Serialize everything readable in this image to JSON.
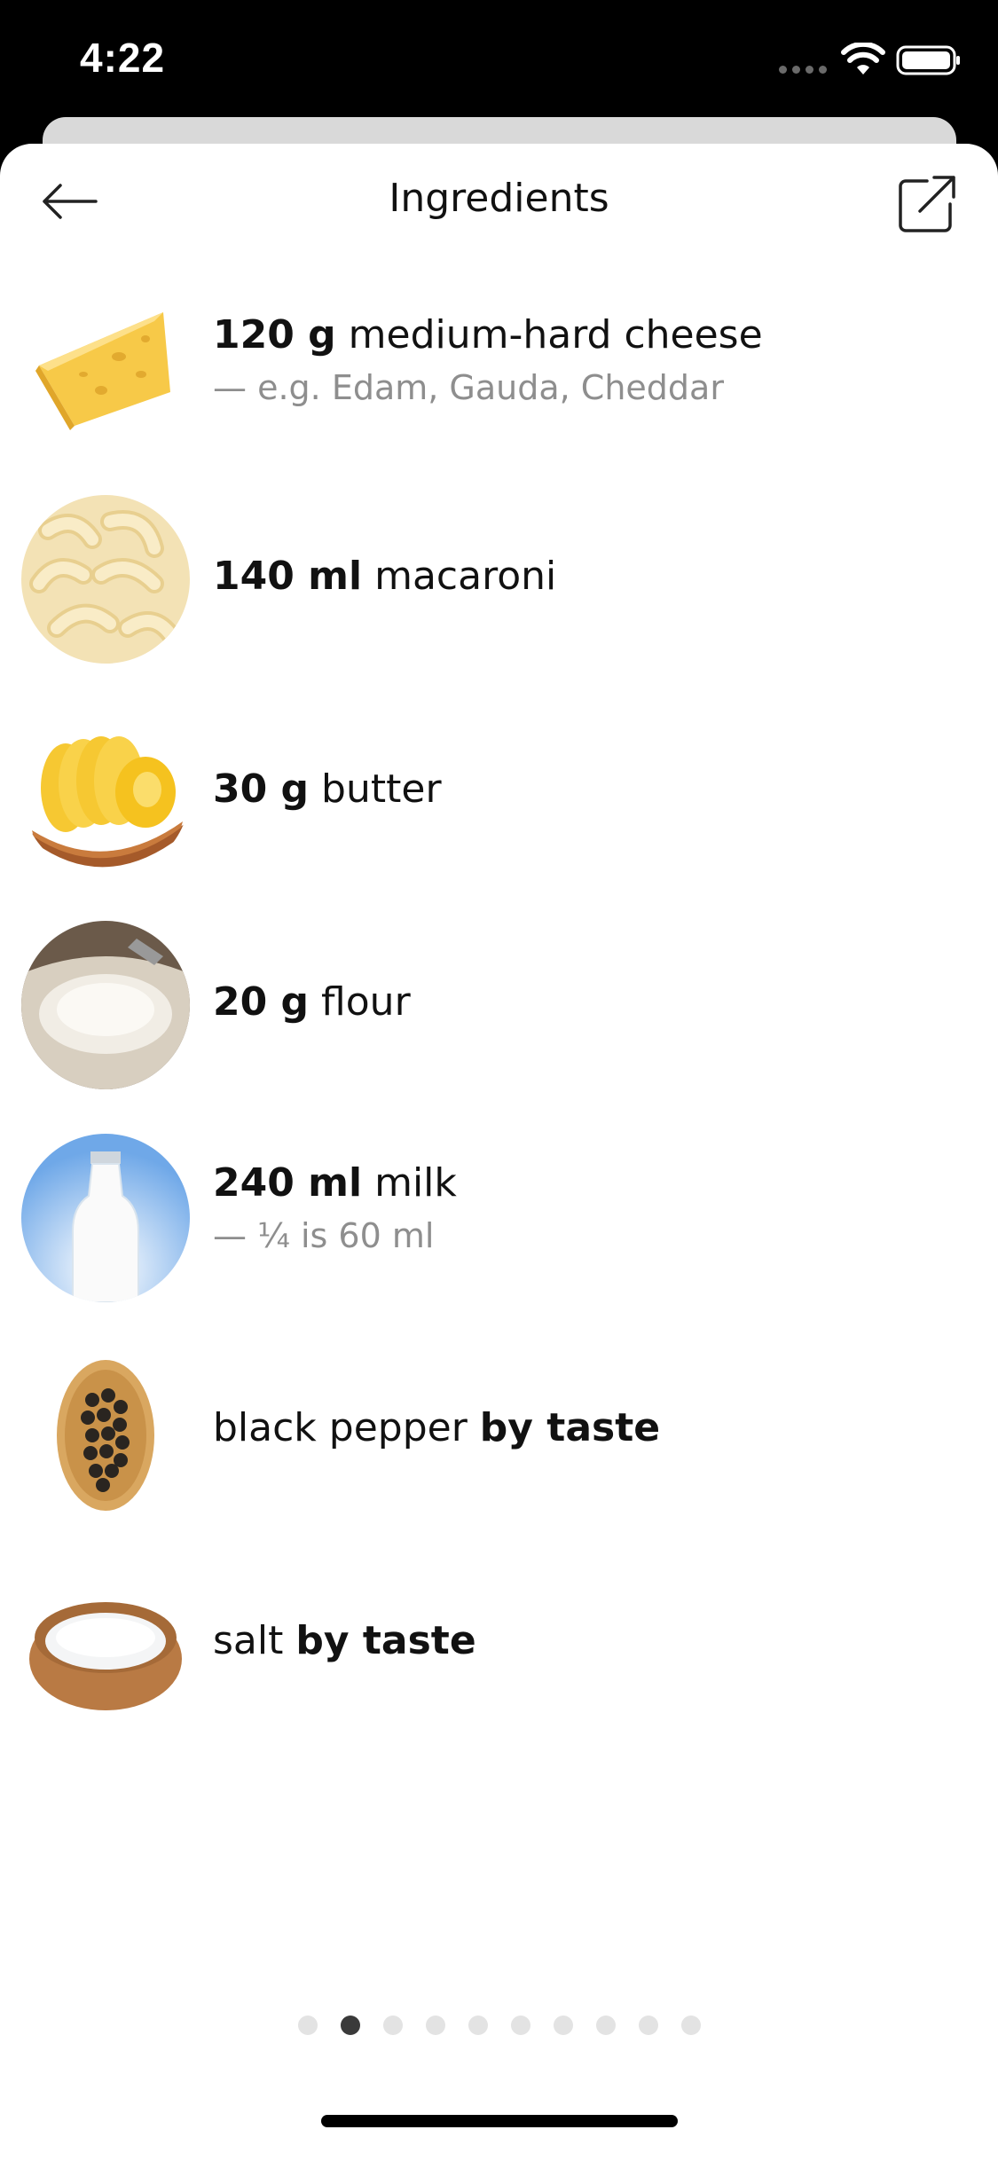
{
  "status_bar": {
    "time": "4:22"
  },
  "header": {
    "title": "Ingredients"
  },
  "ingredients": [
    {
      "amount": "120 g",
      "name": "medium-hard cheese",
      "note": "— e.g. Edam, Gauda, Cheddar",
      "image": "cheese"
    },
    {
      "amount": "140 ml",
      "name": "macaroni",
      "note": "",
      "image": "macaroni"
    },
    {
      "amount": "30 g",
      "name": "butter",
      "note": "",
      "image": "butter"
    },
    {
      "amount": "20 g",
      "name": "flour",
      "note": "",
      "image": "flour"
    },
    {
      "amount": "240 ml",
      "name": "milk",
      "note": "— ¼ is 60 ml",
      "image": "milk"
    },
    {
      "name": "black pepper",
      "amount": "by taste",
      "note": "",
      "image": "black-pepper"
    },
    {
      "name": "salt",
      "amount": "by taste",
      "note": "",
      "image": "salt"
    }
  ],
  "pagination": {
    "total": 10,
    "active": 2
  }
}
